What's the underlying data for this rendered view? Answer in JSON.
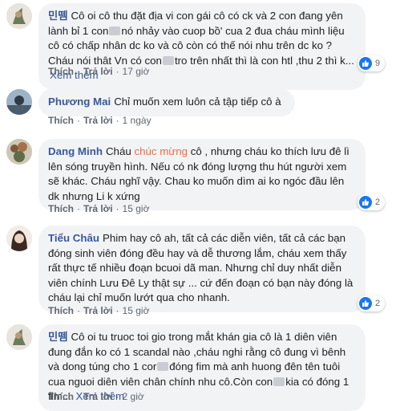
{
  "comments": [
    {
      "author": "민뗌",
      "text_parts": [
        "Cô oi cô thu đặt địa vi con gái cô có ck và 2 con đang yên lành bỉ 1 con",
        "nó nhảy vào cuop bồ' cua 2 đua cháu mình liệu cô có chấp nhân dc ko và cô còn có thế nói nhu trên dc ko ?Cháu nói thât Vn có con",
        "tro trên nhất thì là con htl ,thu 2 thì k..."
      ],
      "see_more": "Xem thêm",
      "like": "Thích",
      "reply": "Trả lời",
      "time": "17 giờ",
      "reactions": "9"
    },
    {
      "author": "Phương Mai",
      "text": "Chỉ muốn xem luôn cả tập tiếp cô à",
      "like": "Thích",
      "reply": "Trả lời",
      "time": "1 ngày"
    },
    {
      "author": "Dang Minh",
      "text_before": "Cháu ",
      "highlight": "chúc mừng",
      "text_after": " cô , nhưng cháu ko thích lưu đê lì lên sóng truyền hình. Nếu có nk đóng lượng thu hút người xem sẽ khác. Cháu nghĩ vậy. Chau ko muốn dìm ai ko ngóc đầu lên dk nhưng Li k xứng",
      "like": "Thích",
      "reply": "Trả lời",
      "time": "15 giờ",
      "reactions": "2"
    },
    {
      "author": "Tiểu Châu",
      "text": "Phim hay cô ah, tất cả các diễn viên, tất cả các bạn đóng sinh viên đóng đều hay và dễ thương lắm, cháu xem thấy rất thực tế nhiều đoạn bcuoi dã man. Nhưng chỉ duy nhất diễn viên chính Lưu Đê Ly thật sự ... cứ đến đoạn có bạn này đóng là cháu lại chỉ muốn lướt qua cho nhanh.",
      "like": "Thích",
      "reply": "Trả lời",
      "time": "15 giờ",
      "reactions": "2"
    },
    {
      "author": "민뗌",
      "text_parts": [
        "Cô oi tu truoc toi gio trong mắt khán gia cô là 1 diên viên đung đắn ko có 1 scandal nào ,cháu nghi rằng cô đung vì bênh và dong túng cho 1 cor",
        "đóng fim mà anh huong đên tên tuôi cua nguoi diên viên chân chính nhu cô.Còn con",
        "kia có đóng 1 fim..."
      ],
      "see_more": "Xem thêm",
      "like": "Thích",
      "reply": "Trả lời",
      "time": "2 giờ"
    }
  ],
  "colors": {
    "name": "#385898",
    "bubble": "#f2f3f5",
    "highlight": "#ef6b4a",
    "like": "#1877f2"
  }
}
